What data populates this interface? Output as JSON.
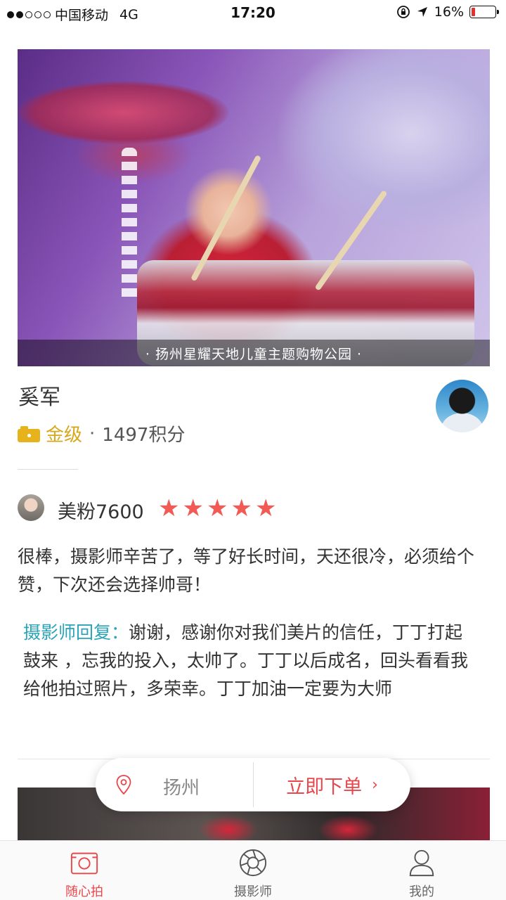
{
  "status_bar": {
    "carrier": "中国移动",
    "network": "4G",
    "time": "17:20",
    "battery": "16%",
    "battery_level": 0.16
  },
  "hero": {
    "caption": "· 扬州星耀天地儿童主题购物公园 ·"
  },
  "photographer": {
    "name": "奚军",
    "level": "金级",
    "separator": "·",
    "points": "1497积分"
  },
  "review": {
    "reviewer": "美粉7600",
    "rating": 5,
    "stars": [
      "★",
      "★",
      "★",
      "★",
      "★"
    ],
    "text": "很棒，摄影师辛苦了，等了好长时间，天还很冷，必须给个赞，下次还会选择帅哥！",
    "reply_label": "摄影师回复：",
    "reply_text": "谢谢，感谢你对我们美片的信任，丁丁打起鼓来 ，忘我的投入，太帅了。丁丁以后成名，回头看看我给他拍过照片，多荣幸。丁丁加油一定要为大师"
  },
  "order_bar": {
    "city": "扬州",
    "order_label": "立即下单",
    "chevron": "›"
  },
  "tab_bar": {
    "tabs": [
      {
        "label": "随心拍",
        "icon": "camera-frame-icon",
        "active": true
      },
      {
        "label": "摄影师",
        "icon": "aperture-icon",
        "active": false
      },
      {
        "label": "我的",
        "icon": "person-icon",
        "active": false
      }
    ]
  },
  "colors": {
    "accent": "#e8474c",
    "gold": "#d8a81c",
    "reply_teal": "#2aa4b8",
    "star": "#f25a56"
  }
}
